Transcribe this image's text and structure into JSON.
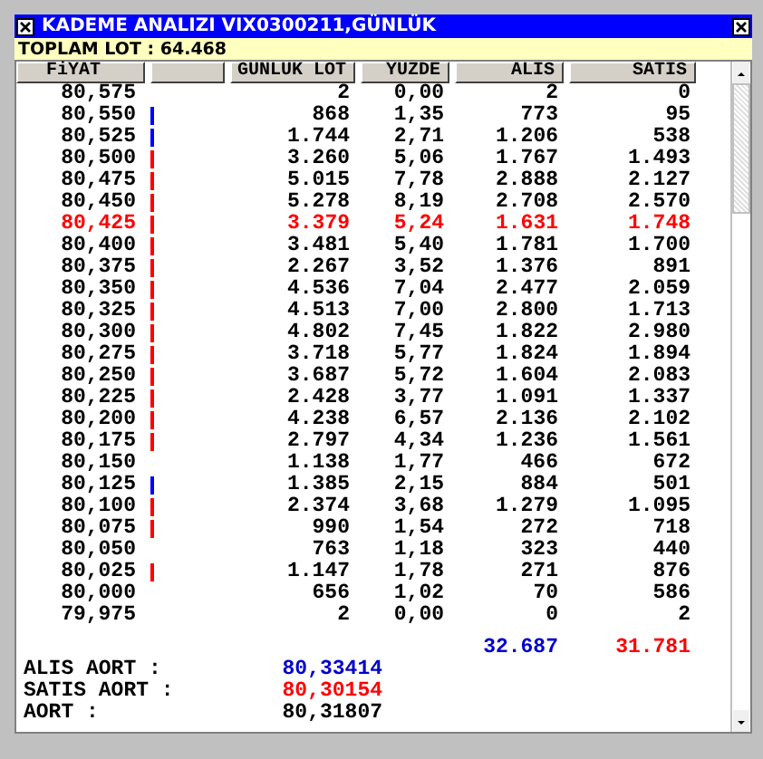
{
  "window": {
    "title": "KADEME ANALIZI VIX0300211,GÜNLÜK"
  },
  "total_lot": "TOPLAM LOT : 64.468",
  "columns": [
    "FiYAT",
    "",
    "GUNLUK LOT",
    "YUZDE",
    "ALIS",
    "SATIS"
  ],
  "rows": [
    {
      "price": "80,575",
      "lot": "2",
      "percent": "0,00",
      "buy": "2",
      "sell": "0",
      "highlighted": false
    },
    {
      "price": "80,550",
      "bar": {
        "color": "#0000ff"
      },
      "lot": "868",
      "percent": "1,35",
      "buy": "773",
      "sell": "95",
      "highlighted": false
    },
    {
      "price": "80,525",
      "bar": {
        "color": "#0000ff"
      },
      "lot": "1.744",
      "percent": "2,71",
      "buy": "1.206",
      "sell": "538",
      "highlighted": false
    },
    {
      "price": "80,500",
      "bar": {
        "color": "#ff0000"
      },
      "lot": "3.260",
      "percent": "5,06",
      "buy": "1.767",
      "sell": "1.493",
      "highlighted": false
    },
    {
      "price": "80,475",
      "bar": {
        "color": "#ff0000"
      },
      "lot": "5.015",
      "percent": "7,78",
      "buy": "2.888",
      "sell": "2.127",
      "highlighted": false
    },
    {
      "price": "80,450",
      "bar": {
        "color": "#ff0000"
      },
      "lot": "5.278",
      "percent": "8,19",
      "buy": "2.708",
      "sell": "2.570",
      "highlighted": false
    },
    {
      "price": "80,425",
      "bar": {
        "color": "#ff0000"
      },
      "lot": "3.379",
      "percent": "5,24",
      "buy": "1.631",
      "sell": "1.748",
      "highlighted": true
    },
    {
      "price": "80,400",
      "bar": {
        "color": "#ff0000"
      },
      "lot": "3.481",
      "percent": "5,40",
      "buy": "1.781",
      "sell": "1.700",
      "highlighted": false
    },
    {
      "price": "80,375",
      "bar": {
        "color": "#ff0000"
      },
      "lot": "2.267",
      "percent": "3,52",
      "buy": "1.376",
      "sell": "891",
      "highlighted": false
    },
    {
      "price": "80,350",
      "bar": {
        "color": "#ff0000"
      },
      "lot": "4.536",
      "percent": "7,04",
      "buy": "2.477",
      "sell": "2.059",
      "highlighted": false
    },
    {
      "price": "80,325",
      "bar": {
        "color": "#ff0000"
      },
      "lot": "4.513",
      "percent": "7,00",
      "buy": "2.800",
      "sell": "1.713",
      "highlighted": false
    },
    {
      "price": "80,300",
      "bar": {
        "color": "#ff0000"
      },
      "lot": "4.802",
      "percent": "7,45",
      "buy": "1.822",
      "sell": "2.980",
      "highlighted": false
    },
    {
      "price": "80,275",
      "bar": {
        "color": "#ff0000"
      },
      "lot": "3.718",
      "percent": "5,77",
      "buy": "1.824",
      "sell": "1.894",
      "highlighted": false
    },
    {
      "price": "80,250",
      "bar": {
        "color": "#ff0000"
      },
      "lot": "3.687",
      "percent": "5,72",
      "buy": "1.604",
      "sell": "2.083",
      "highlighted": false
    },
    {
      "price": "80,225",
      "bar": {
        "color": "#ff0000"
      },
      "lot": "2.428",
      "percent": "3,77",
      "buy": "1.091",
      "sell": "1.337",
      "highlighted": false
    },
    {
      "price": "80,200",
      "bar": {
        "color": "#ff0000"
      },
      "lot": "4.238",
      "percent": "6,57",
      "buy": "2.136",
      "sell": "2.102",
      "highlighted": false
    },
    {
      "price": "80,175",
      "bar": {
        "color": "#ff0000"
      },
      "lot": "2.797",
      "percent": "4,34",
      "buy": "1.236",
      "sell": "1.561",
      "highlighted": false
    },
    {
      "price": "80,150",
      "lot": "1.138",
      "percent": "1,77",
      "buy": "466",
      "sell": "672",
      "highlighted": false
    },
    {
      "price": "80,125",
      "bar": {
        "color": "#0000ff"
      },
      "lot": "1.385",
      "percent": "2,15",
      "buy": "884",
      "sell": "501",
      "highlighted": false
    },
    {
      "price": "80,100",
      "bar": {
        "color": "#ff0000"
      },
      "lot": "2.374",
      "percent": "3,68",
      "buy": "1.279",
      "sell": "1.095",
      "highlighted": false
    },
    {
      "price": "80,075",
      "bar": {
        "color": "#ff0000"
      },
      "lot": "990",
      "percent": "1,54",
      "buy": "272",
      "sell": "718",
      "highlighted": false
    },
    {
      "price": "80,050",
      "lot": "763",
      "percent": "1,18",
      "buy": "323",
      "sell": "440",
      "highlighted": false
    },
    {
      "price": "80,025",
      "bar": {
        "color": "#ff0000"
      },
      "lot": "1.147",
      "percent": "1,78",
      "buy": "271",
      "sell": "876",
      "highlighted": false
    },
    {
      "price": "80,000",
      "lot": "656",
      "percent": "1,02",
      "buy": "70",
      "sell": "586",
      "highlighted": false
    },
    {
      "price": "79,975",
      "lot": "2",
      "percent": "0,00",
      "buy": "0",
      "sell": "2",
      "highlighted": false
    }
  ],
  "totals": {
    "buy": "32.687",
    "sell": "31.781"
  },
  "averages": [
    {
      "label": "ALIS AORT :",
      "value": "80,33414",
      "kind": "buy"
    },
    {
      "label": "SATIS AORT :",
      "value": "80,30154",
      "kind": "sell"
    },
    {
      "label": "AORT :",
      "value": "80,31807",
      "kind": "all"
    }
  ]
}
